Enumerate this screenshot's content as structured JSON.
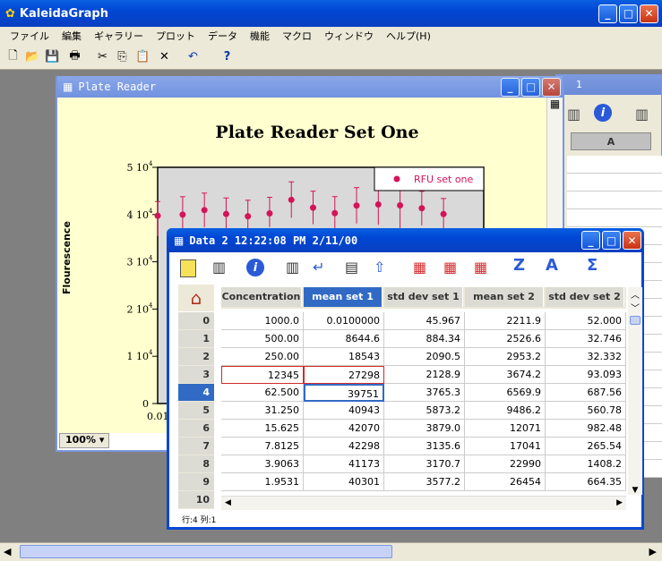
{
  "app": {
    "title": "KaleidaGraph"
  },
  "menu": [
    "ファイル",
    "編集",
    "ギャラリー",
    "プロット",
    "データ",
    "機能",
    "マクロ",
    "ウィンドウ",
    "ヘルプ(H)"
  ],
  "plot_window": {
    "title": "Plate Reader",
    "zoom": "100%"
  },
  "back_window": {
    "title_fragment": "1",
    "col_a": "A"
  },
  "chart_data": {
    "type": "scatter",
    "title": "Plate Reader Set One",
    "ylabel": "Flourescence",
    "xlabel": "",
    "x_tick_first": "0.01",
    "yticks": [
      "0",
      "1 10",
      "2 10",
      "3 10",
      "4 10",
      "5 10"
    ],
    "ytick_exp": "4",
    "ylim": [
      0,
      50000
    ],
    "series": [
      {
        "name": "RFU set one",
        "points": [
          [
            0,
            39751
          ],
          [
            1,
            39980
          ],
          [
            2,
            40943
          ],
          [
            3,
            40120
          ],
          [
            4,
            39630
          ],
          [
            5,
            40250
          ],
          [
            6,
            43120
          ],
          [
            7,
            41450
          ],
          [
            8,
            40300
          ],
          [
            9,
            41900
          ],
          [
            10,
            42140
          ],
          [
            11,
            41950
          ],
          [
            12,
            41330
          ],
          [
            13,
            40100
          ]
        ],
        "errs": [
          [
            4300,
            3000
          ],
          [
            3800,
            3800
          ],
          [
            3600,
            3600
          ],
          [
            3400,
            3400
          ],
          [
            3000,
            3400
          ],
          [
            2900,
            3400
          ],
          [
            3800,
            3800
          ],
          [
            3500,
            3500
          ],
          [
            3500,
            3500
          ],
          [
            3800,
            3800
          ],
          [
            4300,
            4300
          ],
          [
            4800,
            4800
          ],
          [
            3600,
            3600
          ],
          [
            3300,
            3300
          ]
        ]
      }
    ]
  },
  "data_window": {
    "title": "Data 2 12:22:08 PM 2/11/00",
    "columns": [
      "Concentration",
      "mean set 1",
      "std dev set 1",
      "mean set 2",
      "std dev set 2"
    ],
    "row_nums": [
      "0",
      "1",
      "2",
      "3",
      "4",
      "5",
      "6",
      "7",
      "8",
      "9",
      "10"
    ],
    "rows": [
      [
        "1000.0",
        "0.0100000",
        "45.967",
        "2211.9",
        "52.000"
      ],
      [
        "500.00",
        "8644.6",
        "884.34",
        "2526.6",
        "32.746"
      ],
      [
        "250.00",
        "18543",
        "2090.5",
        "2953.2",
        "32.332"
      ],
      [
        "12345",
        "27298",
        "2128.9",
        "3674.2",
        "93.093"
      ],
      [
        "62.500",
        "39751",
        "3765.3",
        "6569.9",
        "687.56"
      ],
      [
        "31.250",
        "40943",
        "5873.2",
        "9486.2",
        "560.78"
      ],
      [
        "15.625",
        "42070",
        "3879.0",
        "12071",
        "982.48"
      ],
      [
        "7.8125",
        "42298",
        "3135.6",
        "17041",
        "265.54"
      ],
      [
        "3.9063",
        "41173",
        "3170.7",
        "22990",
        "1408.2"
      ],
      [
        "1.9531",
        "40301",
        "3577.2",
        "26454",
        "664.35"
      ]
    ],
    "status": "行:4  列:1"
  }
}
